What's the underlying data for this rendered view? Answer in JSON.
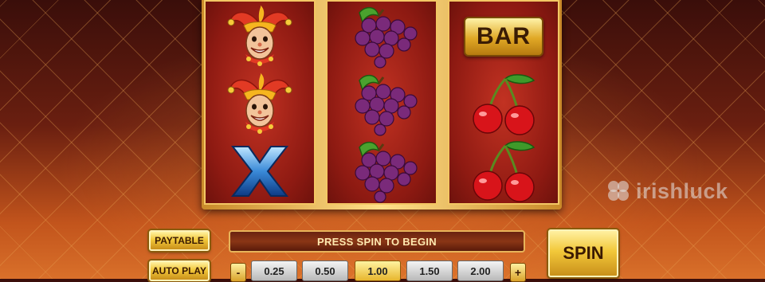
{
  "reels": [
    {
      "symbols": [
        "jester-icon",
        "jester-icon",
        "x-icon"
      ]
    },
    {
      "symbols": [
        "grapes-icon",
        "grapes-icon",
        "grapes-icon"
      ]
    },
    {
      "symbols": [
        "bar-icon",
        "cherries-icon",
        "cherries-icon"
      ]
    }
  ],
  "bar_label": "BAR",
  "buttons": {
    "paytable": "PAYTABLE",
    "autoplay": "AUTO PLAY",
    "spin": "SPIN"
  },
  "message": "PRESS SPIN TO BEGIN",
  "bet": {
    "minus": "-",
    "plus": "+",
    "options": [
      "0.25",
      "0.50",
      "1.00",
      "1.50",
      "2.00"
    ],
    "selected": "1.00"
  },
  "watermark": "irishluck",
  "colors": {
    "reel_bg": "#8e1a12",
    "frame_gold": "#f3c764",
    "button_gold": "#f2c83a"
  }
}
